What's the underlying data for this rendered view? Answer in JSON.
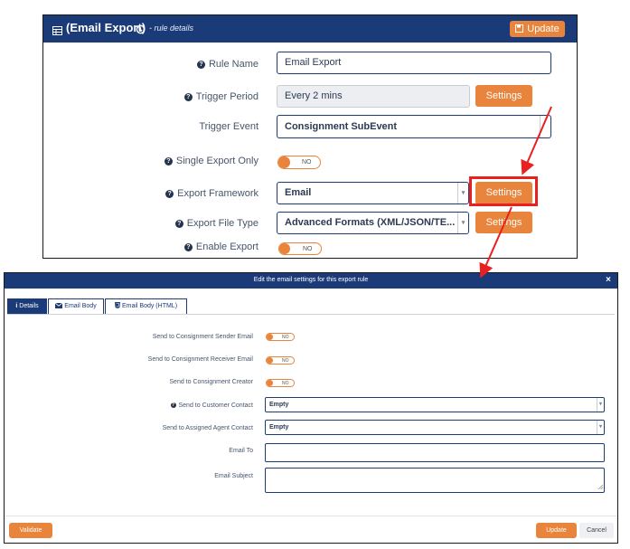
{
  "top": {
    "title": "(Email Export)",
    "subtitle": "- rule details",
    "update_label": "Update",
    "rows": {
      "rule_name": {
        "label": "Rule Name",
        "value": "Email Export"
      },
      "trigger_period": {
        "label": "Trigger Period",
        "value": "Every 2 mins",
        "button": "Settings"
      },
      "trigger_event": {
        "label": "Trigger Event",
        "value": "Consignment SubEvent"
      },
      "single_export": {
        "label": "Single Export Only",
        "toggle": "NO"
      },
      "export_framework": {
        "label": "Export Framework",
        "value": "Email",
        "button": "Settings"
      },
      "export_file_type": {
        "label": "Export File Type",
        "value": "Advanced Formats (XML/JSON/TE...",
        "button": "Settings"
      },
      "enable_export": {
        "label": "Enable Export",
        "toggle": "NO"
      }
    }
  },
  "modal": {
    "title": "Edit the email settings for this export rule",
    "close": "×",
    "tabs": [
      {
        "label": "Details",
        "icon": "info-icon"
      },
      {
        "label": "Email Body",
        "icon": "envelope-icon"
      },
      {
        "label": "Email Body (HTML)",
        "icon": "html5-icon"
      }
    ],
    "rows": {
      "sender": {
        "label": "Send to Consignment Sender Email",
        "toggle": "NO"
      },
      "receiver": {
        "label": "Send to Consignment Receiver Email",
        "toggle": "NO"
      },
      "creator": {
        "label": "Send to Consignment Creator",
        "toggle": "NO"
      },
      "customer_contact": {
        "label": "Send to Customer Contact",
        "value": "Empty"
      },
      "assigned_agent": {
        "label": "Send to Assigned Agent Contact",
        "value": "Empty"
      },
      "email_to": {
        "label": "Email To",
        "value": ""
      },
      "email_subject": {
        "label": "Email Subject",
        "value": ""
      }
    },
    "validate_label": "Validate",
    "update_label": "Update",
    "cancel_label": "Cancel"
  },
  "colors": {
    "header": "#1b3a78",
    "accent": "#e8843c",
    "highlight": "#e8201f"
  }
}
